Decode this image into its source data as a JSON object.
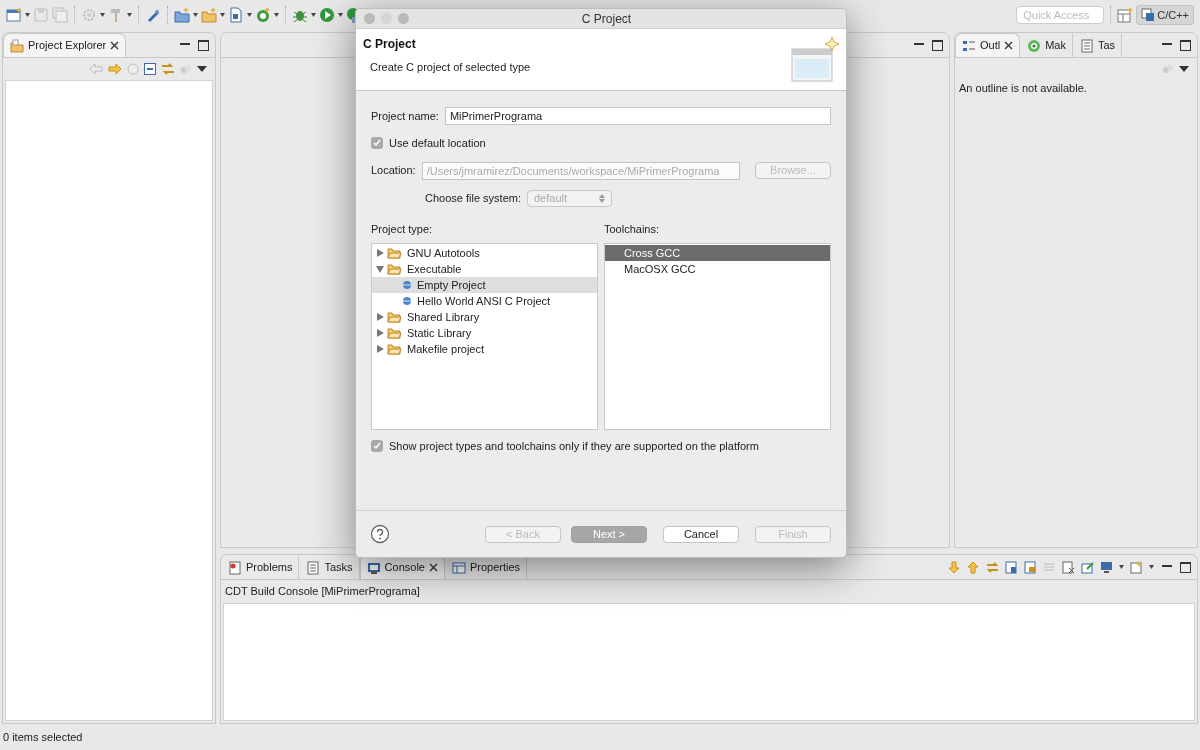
{
  "toolbar": {
    "quick_access": {
      "placeholder": "Quick Access"
    },
    "perspective": {
      "label": "C/C++",
      "selected": true
    }
  },
  "project_explorer": {
    "tab": {
      "label": "Project Explorer",
      "selected": true
    }
  },
  "outline_panel": {
    "tabs": [
      {
        "label": "Outl",
        "selected": true,
        "kind": "outline"
      },
      {
        "label": "Mak",
        "selected": false,
        "kind": "target"
      },
      {
        "label": "Tas",
        "selected": false,
        "kind": "tasks"
      }
    ],
    "message": "An outline is not available."
  },
  "bottom_panel": {
    "tabs": [
      {
        "label": "Problems",
        "selected": false,
        "kind": "problems"
      },
      {
        "label": "Tasks",
        "selected": false,
        "kind": "tasks"
      },
      {
        "label": "Console",
        "selected": true,
        "kind": "console"
      },
      {
        "label": "Properties",
        "selected": false,
        "kind": "properties"
      }
    ],
    "console_title": "CDT Build Console [MiPrimerPrograma]"
  },
  "status_bar": "0 items selected",
  "dialog": {
    "title": "C Project",
    "header_title": "C Project",
    "header_subtitle": "Create C project of selected type",
    "project_name": {
      "label": "Project name:",
      "value": "MiPrimerPrograma"
    },
    "use_default_location": {
      "label": "Use default location",
      "checked": true
    },
    "location": {
      "label": "Location:",
      "value": "/Users/jmramirez/Documents/workspace/MiPrimerPrograma",
      "disabled": true
    },
    "browse": {
      "label": "Browse...",
      "disabled": true
    },
    "file_system": {
      "label": "Choose file system:",
      "value": "default",
      "disabled": true
    },
    "project_type": {
      "label": "Project type:",
      "items": [
        {
          "label": "GNU Autotools",
          "kind": "folder",
          "expanded": false,
          "selected": false
        },
        {
          "label": "Executable",
          "kind": "folder",
          "expanded": true,
          "selected": false,
          "children": [
            {
              "label": "Empty Project",
              "kind": "template",
              "selected": true
            },
            {
              "label": "Hello World ANSI C Project",
              "kind": "template",
              "selected": false
            }
          ]
        },
        {
          "label": "Shared Library",
          "kind": "folder",
          "expanded": false,
          "selected": false
        },
        {
          "label": "Static Library",
          "kind": "folder",
          "expanded": false,
          "selected": false
        },
        {
          "label": "Makefile project",
          "kind": "folder",
          "expanded": false,
          "selected": false
        }
      ]
    },
    "toolchains": {
      "label": "Toolchains:",
      "items": [
        {
          "label": "Cross GCC",
          "selected": true
        },
        {
          "label": "MacOSX GCC",
          "selected": false
        }
      ]
    },
    "show_supported": {
      "label": "Show project types and toolchains only if they are supported on the platform",
      "checked": true
    },
    "buttons": [
      {
        "label": "< Back",
        "disabled": true,
        "default": false
      },
      {
        "label": "Next >",
        "disabled": false,
        "default": true
      },
      {
        "label": "Cancel",
        "disabled": false,
        "default": false
      },
      {
        "label": "Finish",
        "disabled": true,
        "default": false
      }
    ]
  }
}
